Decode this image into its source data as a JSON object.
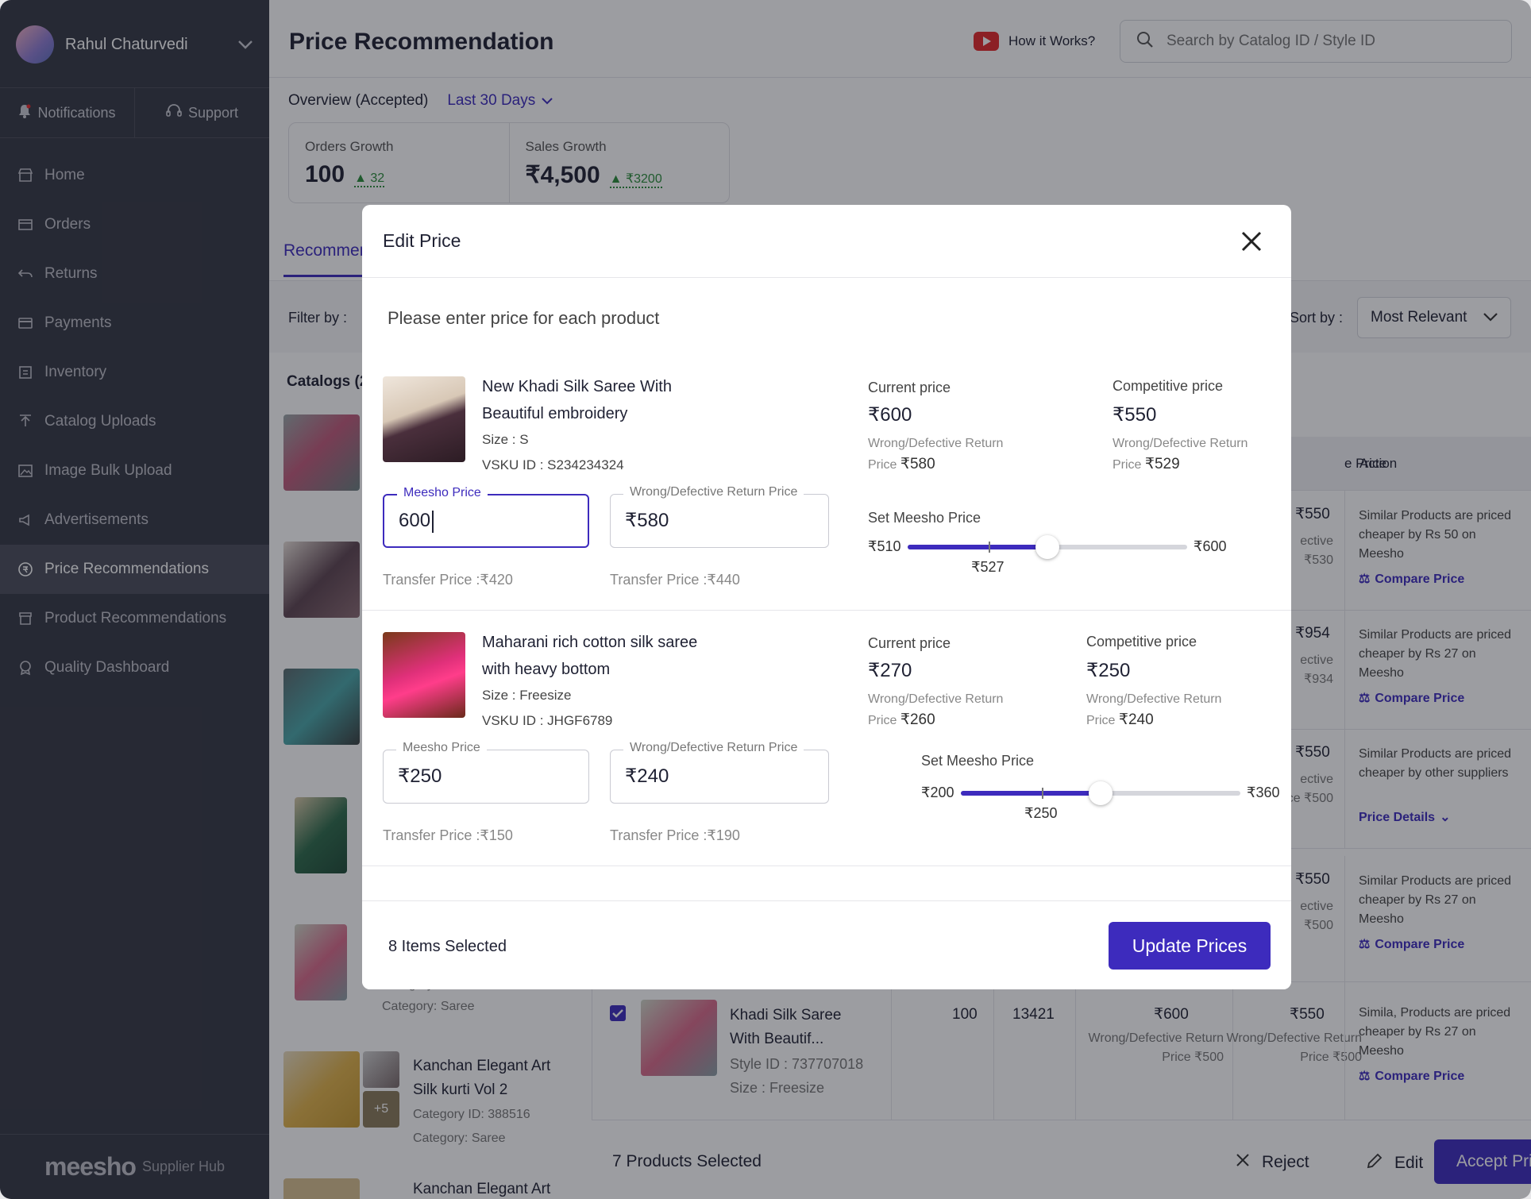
{
  "sidebar": {
    "user_name": "Rahul Chaturvedi",
    "notifications": "Notifications",
    "support": "Support",
    "items": [
      {
        "label": "Home",
        "icon": "store-icon"
      },
      {
        "label": "Orders",
        "icon": "box-icon"
      },
      {
        "label": "Returns",
        "icon": "return-icon"
      },
      {
        "label": "Payments",
        "icon": "card-icon"
      },
      {
        "label": "Inventory",
        "icon": "inventory-icon"
      },
      {
        "label": "Catalog Uploads",
        "icon": "upload-icon"
      },
      {
        "label": "Image Bulk Upload",
        "icon": "image-icon"
      },
      {
        "label": "Advertisements",
        "icon": "megaphone-icon"
      },
      {
        "label": "Price Recommendations",
        "icon": "price-icon",
        "active": true
      },
      {
        "label": "Product Recommendations",
        "icon": "product-icon"
      },
      {
        "label": "Quality Dashboard",
        "icon": "badge-icon"
      }
    ],
    "brand": "meesho",
    "brand_sub": "Supplier Hub"
  },
  "header": {
    "title": "Price Recommendation",
    "how_it_works": "How it Works?",
    "search_placeholder": "Search by Catalog ID / Style ID"
  },
  "overview": {
    "label": "Overview (Accepted)",
    "period": "Last 30 Days",
    "orders_label": "Orders Growth",
    "orders_value": "100",
    "orders_delta": "32",
    "sales_label": "Sales Growth",
    "sales_value": "₹4,500",
    "sales_delta": "₹3200"
  },
  "tabs": {
    "active": "Recommendations"
  },
  "filters": {
    "filter_label": "Filter by :",
    "sort_label": "Sort by :",
    "sort_value": "Most Relevant",
    "catalogs": "Catalogs (2"
  },
  "table": {
    "col_price": "e Price",
    "col_action": "Action",
    "rows": [
      {
        "price": "₹550",
        "ret1": "ective",
        "ret2": "₹530",
        "action": "Similar Products are priced cheaper by Rs 50 on Meesho",
        "link": "Compare Price"
      },
      {
        "price": "₹954",
        "ret1": "ective",
        "ret2": "₹934",
        "action": "Similar Products are priced cheaper by Rs 27 on Meesho",
        "link": "Compare Price"
      },
      {
        "price": "₹550",
        "ret1": "ective",
        "ret2": "Price ₹500",
        "action": "Similar Products are priced cheaper by other suppliers",
        "link": "Price Details"
      },
      {
        "price": "₹550",
        "ret1": "ective",
        "ret2": "₹500",
        "action": "Similar Products are priced cheaper by Rs 27 on Meesho",
        "link": "Compare Price"
      }
    ],
    "visible_row": {
      "name1": "Khadi Silk Saree",
      "name2": "With Beautif...",
      "style": "Style ID : 737707018",
      "size": "Size : Freesize",
      "qty": "100",
      "views": "13421",
      "current": "₹600",
      "current_ret": "Wrong/Defective Return Price ₹500",
      "comp": "₹550",
      "comp_ret": "Wrong/Defective Return Price ₹500",
      "action": "Simila, Products are priced cheaper by Rs 27 on Meesho",
      "link": "Compare Price"
    },
    "catalog_left": [
      {
        "line1": "Category ID: 388516",
        "line2": "Category: Saree"
      },
      {
        "name1": "Kanchan Elegant Art",
        "name2": "Silk kurti Vol 2",
        "line1": "Category ID: 388516",
        "line2": "Category: Saree",
        "more": "+5"
      },
      {
        "name1": "Kanchan Elegant Art"
      }
    ]
  },
  "bottom_bar": {
    "selected": "7 Products Selected",
    "reject": "Reject",
    "edit": "Edit",
    "accept": "Accept Price"
  },
  "modal": {
    "title": "Edit Price",
    "subtitle": "Please enter price for each product",
    "products": [
      {
        "name_line1": "New Khadi Silk Saree With",
        "name_line2": "Beautiful embroidery",
        "size": "Size : S",
        "vsku": "VSKU ID : S234234324",
        "current_label": "Current price",
        "current_price": "₹600",
        "current_ret_label": "Wrong/Defective Return",
        "current_ret_prefix": "Price",
        "current_ret_value": "₹580",
        "comp_label": "Competitive price",
        "comp_price": "₹550",
        "comp_ret_label": "Wrong/Defective Return",
        "comp_ret_prefix": "Price",
        "comp_ret_value": "₹529",
        "meesho_label": "Meesho Price",
        "meesho_value": "600",
        "ret_field_label": "Wrong/Defective Return Price",
        "ret_field_value": "₹580",
        "transfer1": "Transfer Price :₹420",
        "transfer2": "Transfer Price :₹440",
        "set_label": "Set Meesho Price",
        "slider_min": "₹510",
        "slider_max": "₹600",
        "slider_mark": "₹527",
        "slider_fraction": 0.5,
        "mark_fraction": 0.29
      },
      {
        "name_line1": "Maharani rich cotton silk saree",
        "name_line2": "with heavy bottom",
        "size": "Size : Freesize",
        "vsku": "VSKU ID : JHGF6789",
        "current_label": "Current price",
        "current_price": "₹270",
        "current_ret_label": "Wrong/Defective Return",
        "current_ret_prefix": "Price",
        "current_ret_value": "₹260",
        "comp_label": "Competitive price",
        "comp_price": "₹250",
        "comp_ret_label": "Wrong/Defective Return",
        "comp_ret_prefix": "Price",
        "comp_ret_value": "₹240",
        "meesho_label": "Meesho Price",
        "meesho_value": "₹250",
        "ret_field_label": "Wrong/Defective Return Price",
        "ret_field_value": "₹240",
        "transfer1": "Transfer Price :₹150",
        "transfer2": "Transfer Price :₹190",
        "set_label": "Set Meesho Price",
        "slider_min": "₹200",
        "slider_max": "₹360",
        "slider_mark": "₹250",
        "slider_fraction": 0.5,
        "mark_fraction": 0.29
      }
    ],
    "items_selected": "8 Items Selected",
    "update_button": "Update Prices"
  },
  "colors": {
    "accent": "#3d2bbd",
    "sidebar": "#353744",
    "growth": "#2a8c3a",
    "youtube": "#e4282a"
  }
}
